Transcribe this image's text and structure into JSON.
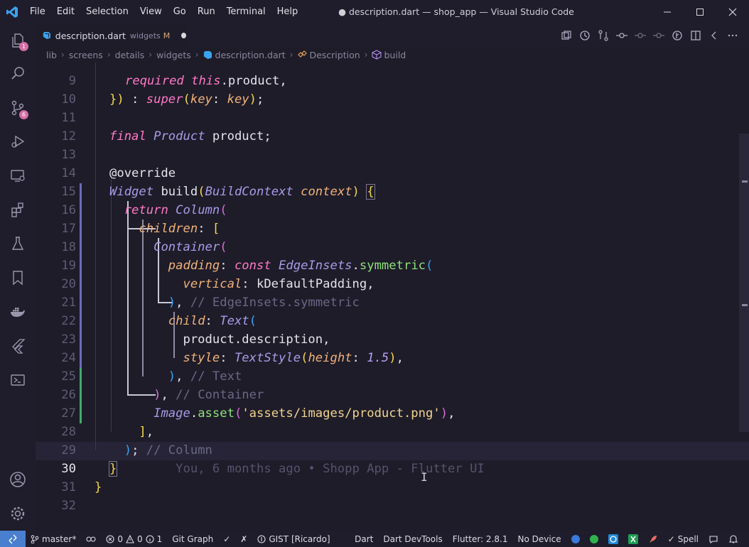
{
  "window": {
    "title": "● description.dart — shop_app — Visual Studio Code"
  },
  "menu": [
    "File",
    "Edit",
    "Selection",
    "View",
    "Go",
    "Run",
    "Terminal",
    "Help"
  ],
  "activity_bar": {
    "explorer_badge": "1",
    "scm_badge": "6"
  },
  "tab": {
    "name": "description.dart",
    "folder": "widgets",
    "modified": "M"
  },
  "breadcrumbs": [
    "lib",
    "screens",
    "details",
    "widgets",
    "description.dart",
    "Description",
    "build"
  ],
  "code": {
    "top_partial_text": "required this.product,",
    "lines": [
      {
        "n": "10"
      },
      {
        "n": "11"
      },
      {
        "n": "12"
      },
      {
        "n": "13"
      },
      {
        "n": "14"
      },
      {
        "n": "15"
      },
      {
        "n": "16"
      },
      {
        "n": "17"
      },
      {
        "n": "18"
      },
      {
        "n": "19"
      },
      {
        "n": "20"
      },
      {
        "n": "21"
      },
      {
        "n": "22"
      },
      {
        "n": "23"
      },
      {
        "n": "24"
      },
      {
        "n": "25"
      },
      {
        "n": "26"
      },
      {
        "n": "27"
      },
      {
        "n": "28"
      },
      {
        "n": "29"
      },
      {
        "n": "30"
      },
      {
        "n": "31"
      },
      {
        "n": "32"
      }
    ],
    "blame": "You, 6 months ago • Shopp App - Flutter UI"
  },
  "status": {
    "branch": "master*",
    "errors": "0",
    "warnings": "0",
    "info": "1",
    "git_graph": "Git Graph",
    "gist": "GIST [Ricardo]",
    "language": "Dart",
    "devtools": "Dart DevTools",
    "flutter": "Flutter: 2.8.1",
    "device": "No Device",
    "spell": "Spell"
  },
  "colors": {
    "editor_bg": "#1e1c29",
    "keyword": "#ff79c6",
    "type": "#a69ce6",
    "function": "#8ee27a",
    "param": "#f1b27a",
    "string": "#f1d48d",
    "comment": "#6a6785"
  }
}
